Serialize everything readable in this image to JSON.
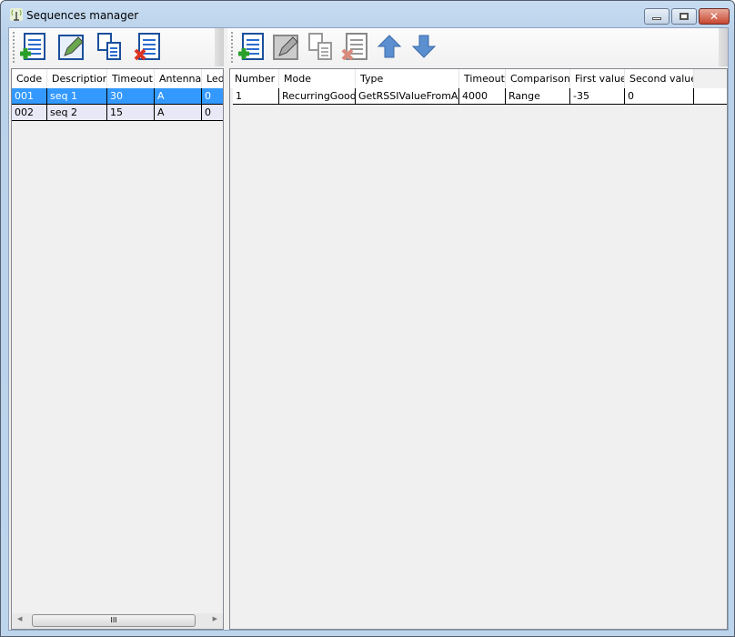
{
  "window": {
    "title": "Sequences manager",
    "controls": [
      "minimize",
      "maximize",
      "close"
    ]
  },
  "left": {
    "toolbar": [
      {
        "icon": "add-list-icon",
        "label": "Add"
      },
      {
        "icon": "edit-pencil-icon",
        "label": "Edit"
      },
      {
        "icon": "copy-icon",
        "label": "Copy"
      },
      {
        "icon": "delete-list-icon",
        "label": "Delete"
      }
    ],
    "columns": [
      "Code",
      "Description",
      "Timeout",
      "Antenna",
      "Led"
    ],
    "rows": [
      [
        "001",
        "seq 1",
        "30",
        "A",
        "0"
      ],
      [
        "002",
        "seq 2",
        "15",
        "A",
        "0"
      ]
    ],
    "scroll_thumb": "III"
  },
  "right": {
    "toolbar": [
      {
        "icon": "add-list-icon",
        "label": "Add"
      },
      {
        "icon": "edit-pencil-icon",
        "label": "Edit"
      },
      {
        "icon": "copy-icon",
        "label": "Copy"
      },
      {
        "icon": "delete-list-icon",
        "label": "Delete"
      },
      {
        "icon": "arrow-up-icon",
        "label": "Move up"
      },
      {
        "icon": "arrow-down-icon",
        "label": "Move down"
      }
    ],
    "columns": [
      "Number",
      "Mode",
      "Type",
      "Timeout",
      "Comparison",
      "First value",
      "Second value"
    ],
    "rows": [
      [
        "1",
        "RecurringGood",
        "GetRSSIValueFromAP",
        "4000",
        "Range",
        "-35",
        "0"
      ]
    ]
  },
  "colors": {
    "selection": "#3399ff",
    "alt_row": "#e8e8f6"
  }
}
